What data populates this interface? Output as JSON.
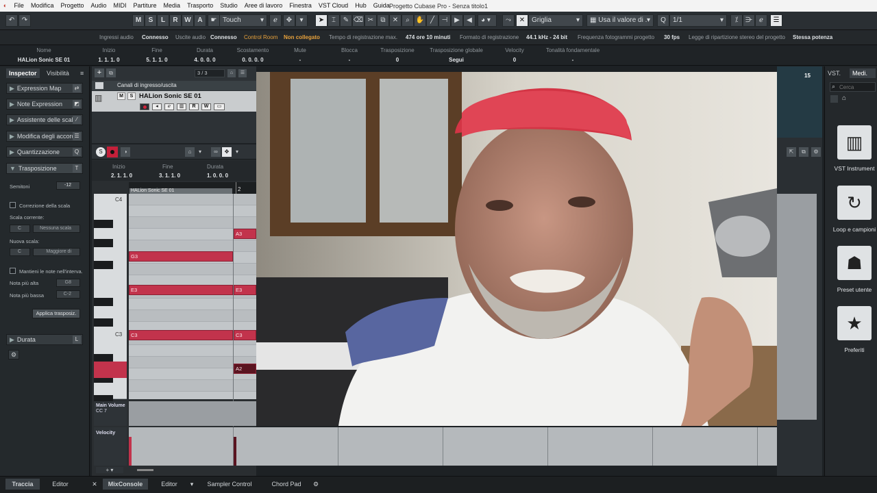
{
  "window": {
    "title": "Progetto Cubase Pro - Senza titolo1"
  },
  "menu": [
    "File",
    "Modifica",
    "Progetto",
    "Audio",
    "MIDI",
    "Partiture",
    "Media",
    "Trasporto",
    "Studio",
    "Aree di lavoro",
    "Finestra",
    "VST Cloud",
    "Hub",
    "Guida"
  ],
  "toolbar": {
    "undo": "↶",
    "redo": "↷",
    "mode_buttons": [
      "M",
      "S",
      "L",
      "R",
      "W",
      "A"
    ],
    "automation_mode": "Touch",
    "snap_mode": "Griglia",
    "quantize_mode": "Usa il valore di .",
    "quantize_value": "1/1"
  },
  "status": {
    "inputs_label": "Ingressi audio",
    "inputs_value": "Connesso",
    "outputs_label": "Uscite audio",
    "outputs_value": "Connesso",
    "control_room_label": "Control Room",
    "control_room_value": "Non collegato",
    "rec_time_label": "Tempo di registrazione max.",
    "rec_time_value": "474 ore 10 minuti",
    "rec_format_label": "Formato di registrazione",
    "rec_format_value": "44.1 kHz - 24 bit",
    "frame_rate_label": "Frequenza fotogrammi progetto",
    "frame_rate_value": "30 fps",
    "pan_law_label": "Legge di ripartizione stereo del progetto",
    "pan_law_value": "Stessa potenza"
  },
  "infoline": [
    {
      "label": "Nome",
      "value": "HALion Sonic SE 01"
    },
    {
      "label": "Inizio",
      "value": "1. 1. 1.   0"
    },
    {
      "label": "Fine",
      "value": "5. 1. 1.   0"
    },
    {
      "label": "Durata",
      "value": "4. 0. 0.   0"
    },
    {
      "label": "Scostamento",
      "value": "0. 0. 0.   0"
    },
    {
      "label": "Mute",
      "value": "-"
    },
    {
      "label": "Blocca",
      "value": "-"
    },
    {
      "label": "Trasposizione",
      "value": "0"
    },
    {
      "label": "Trasposizione globale",
      "value": "Segui"
    },
    {
      "label": "Velocity",
      "value": "0"
    },
    {
      "label": "Tonalità fondamentale",
      "value": "-"
    }
  ],
  "inspector": {
    "tabs": [
      "Inspector",
      "Visibilità"
    ],
    "sections": [
      "Expression Map",
      "Note Expression",
      "Assistente delle scale",
      "Modifica degli accordi",
      "Quantizzazione",
      "Trasposizione"
    ],
    "semitoni_label": "Semitoni",
    "semitoni_value": "-12",
    "scale_correction": "Correzione della scala",
    "current_scale": "Scala corrente:",
    "current_key": "C",
    "current_type": "Nessuna scala",
    "new_scale": "Nuova scala:",
    "new_key": "C",
    "new_type": "Maggiore di",
    "keep_notes": "Mantieni le note nell'interva.",
    "highest_label": "Nota più alta",
    "highest_value": "G8",
    "lowest_label": "Nota più bassa",
    "lowest_value": "C-2",
    "apply_button": "Applica trasposiz.",
    "duration_section": "Durata"
  },
  "tracks": {
    "counter": "3 / 3",
    "folder": "Canali di ingresso/uscita",
    "track_name": "HALion Sonic SE 01",
    "ruler_value": "15"
  },
  "editor": {
    "start_label": "Inizio",
    "start_value": "2. 1. 1.   0",
    "end_label": "Fine",
    "end_value": "3. 1. 1.   0",
    "length_label": "Durata",
    "length_value": "1. 0. 0.   0",
    "part_name": "HALion Sonic SE 01",
    "bar_marker": "2",
    "key_labels": [
      "C4",
      "C3"
    ],
    "notes": [
      {
        "label": "A3"
      },
      {
        "label": "G3"
      },
      {
        "label": "E3"
      },
      {
        "label": "E3"
      },
      {
        "label": "C3"
      },
      {
        "label": "C3"
      },
      {
        "label": "A2"
      }
    ],
    "controller_lane": "Main Volume",
    "controller_cc": "CC 7",
    "velocity_lane": "Velocity"
  },
  "media": {
    "tabs": [
      "VST.",
      "Medi."
    ],
    "search_placeholder": "Cerca",
    "tiles": [
      {
        "label": "VST Instrument",
        "icon": "piano-keys-icon"
      },
      {
        "label": "Loop e campioni",
        "icon": "loop-icon"
      },
      {
        "label": "Preset utente",
        "icon": "user-preset-icon"
      },
      {
        "label": "Preferiti",
        "icon": "star-icon"
      }
    ]
  },
  "bottom": {
    "left_tabs": [
      "Traccia",
      "Editor"
    ],
    "right_tabs": [
      "MixConsole",
      "Editor",
      "Sampler Control",
      "Chord Pad"
    ]
  },
  "colors": {
    "note": "#c2334c",
    "selected_key": "#c2334c",
    "accent_orange": "#e8a23c"
  }
}
